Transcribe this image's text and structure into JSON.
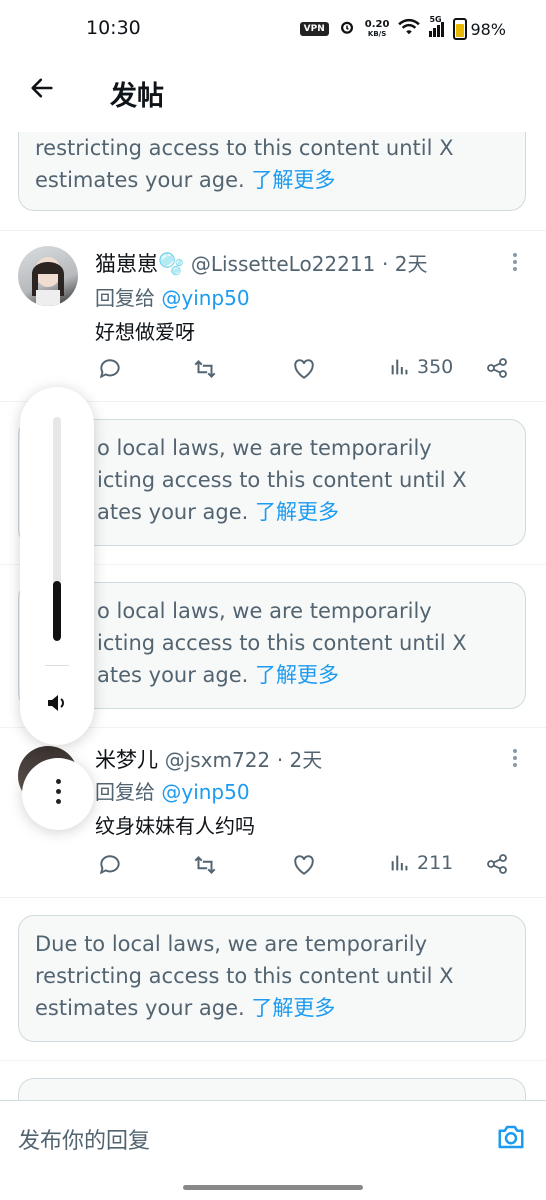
{
  "status_bar": {
    "time": "10:30",
    "vpn": "VPN",
    "speed_value": "0.20",
    "speed_unit": "KB/S",
    "network": "5G",
    "battery": "98%"
  },
  "header": {
    "title": "发帖"
  },
  "notice": {
    "text_full": "Due to local laws, we are temporarily restricting access to this content until X estimates your age.",
    "text_partial_top": "restricting access to this content until X estimates your age.",
    "text_obscured": "o local laws, we are temporarily",
    "text_obscured_2": "icting access to this content until X",
    "text_obscured_3": "ates your age.",
    "link": "了解更多"
  },
  "tweets": [
    {
      "name": "猫崽崽🫧",
      "handle": "@LissetteLo22211",
      "time": "· 2天",
      "reply_label": "回复给",
      "reply_to": "@yinp50",
      "text": "好想做爱呀",
      "views": "350"
    },
    {
      "name": "米梦儿",
      "handle": "@jsxm722",
      "time": "· 2天",
      "reply_label": "回复给",
      "reply_to": "@yinp50",
      "text": "纹身妹妹有人约吗",
      "views": "211"
    }
  ],
  "reply_bar": {
    "placeholder": "发布你的回复"
  },
  "volume": {
    "level": 0.27
  },
  "colors": {
    "link": "#1d9bf0",
    "text": "#0f1419",
    "muted": "#536471",
    "notice_bg": "#f7f9f9"
  }
}
